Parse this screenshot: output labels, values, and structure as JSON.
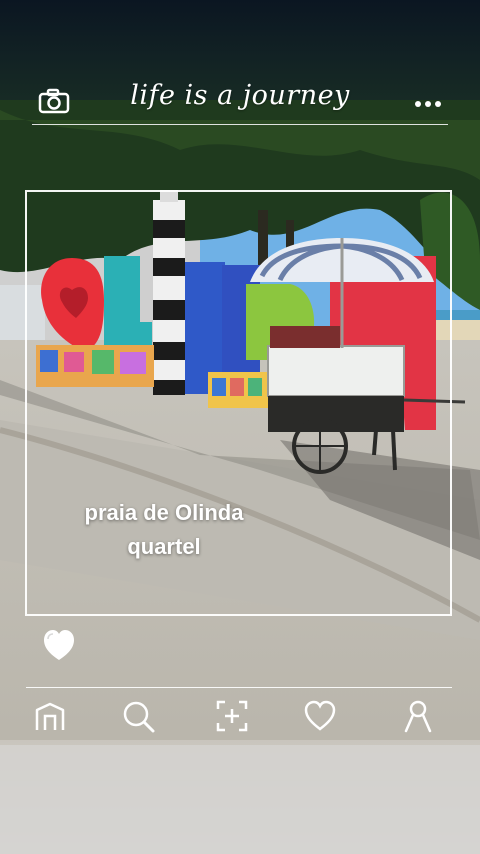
{
  "header": {
    "title": "life is a journey",
    "camera_icon": "camera-icon",
    "more_icon": "more-dots-icon"
  },
  "caption": {
    "line1": "praia de Olinda",
    "line2": "quartel"
  },
  "like": {
    "icon": "heart-icon",
    "liked": true
  },
  "bottom_nav": [
    {
      "name": "home",
      "icon": "home-icon"
    },
    {
      "name": "search",
      "icon": "search-icon"
    },
    {
      "name": "add",
      "icon": "add-icon"
    },
    {
      "name": "likes",
      "icon": "heart-outline-icon"
    },
    {
      "name": "profile",
      "icon": "profile-icon"
    }
  ],
  "photo": {
    "sign_text": "OLINDA",
    "colors": {
      "sky": "#6fb1e6",
      "sign_red": "#e8303a",
      "sign_teal": "#2bb0b5",
      "sign_blue": "#2f59c8",
      "sign_green": "#8cc63f",
      "umbrella": "#e8ecf3"
    }
  }
}
